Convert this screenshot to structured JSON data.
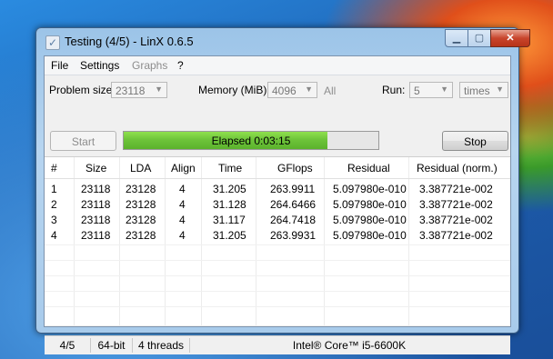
{
  "window": {
    "title": "Testing (4/5) - LinX 0.6.5"
  },
  "menu": [
    {
      "label": "File"
    },
    {
      "label": "Settings"
    },
    {
      "label": "Graphs"
    },
    {
      "label": "?"
    }
  ],
  "controls": {
    "problem_size_label": "Problem size:",
    "problem_size_value": "23118",
    "memory_label": "Memory (MiB):",
    "memory_value": "4096",
    "all_label": "All",
    "run_label": "Run:",
    "run_value": "5",
    "run_unit": "times",
    "start_label": "Start",
    "stop_label": "Stop",
    "progress_text": "Elapsed 0:03:15",
    "progress_fraction": 0.8
  },
  "table": {
    "columns": [
      "#",
      "Size",
      "LDA",
      "Align",
      "Time",
      "GFlops",
      "Residual",
      "Residual (norm.)"
    ],
    "rows": [
      [
        "1",
        "23118",
        "23128",
        "4",
        "31.205",
        "263.9911",
        "5.097980e-010",
        "3.387721e-002"
      ],
      [
        "2",
        "23118",
        "23128",
        "4",
        "31.128",
        "264.6466",
        "5.097980e-010",
        "3.387721e-002"
      ],
      [
        "3",
        "23118",
        "23128",
        "4",
        "31.117",
        "264.7418",
        "5.097980e-010",
        "3.387721e-002"
      ],
      [
        "4",
        "23118",
        "23128",
        "4",
        "31.205",
        "263.9931",
        "5.097980e-010",
        "3.387721e-002"
      ]
    ]
  },
  "status": {
    "run": "4/5",
    "bits": "64-bit",
    "threads": "4 threads",
    "cpu": "Intel® Core™ i5-6600K"
  },
  "colors": {
    "progress_fill": "#6ec43a",
    "close_button": "#c8452c"
  }
}
